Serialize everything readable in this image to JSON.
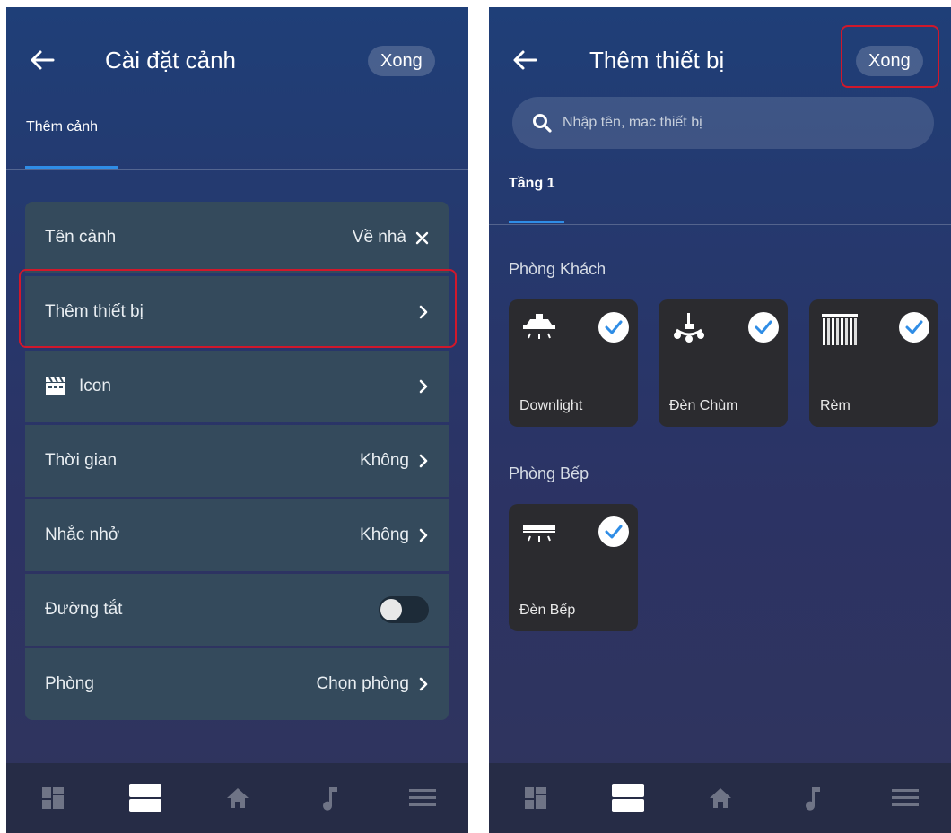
{
  "left": {
    "header": {
      "title": "Cài đặt cảnh",
      "done_label": "Xong"
    },
    "tab": {
      "label": "Thêm cảnh"
    },
    "rows": [
      {
        "label": "Tên cảnh",
        "value": "Về nhà"
      },
      {
        "label": "Thêm thiết bị",
        "value": ""
      },
      {
        "label": "Icon",
        "value": ""
      },
      {
        "label": "Thời gian",
        "value": "Không"
      },
      {
        "label": "Nhắc nhở",
        "value": "Không"
      },
      {
        "label": "Đường tắt",
        "value": "",
        "toggle_on": false
      },
      {
        "label": "Phòng",
        "value": "Chọn phòng"
      }
    ]
  },
  "right": {
    "header": {
      "title": "Thêm thiết bị",
      "done_label": "Xong"
    },
    "search": {
      "placeholder": "Nhập tên, mac thiết bị"
    },
    "tab": {
      "label": "Tầng 1"
    },
    "rooms": [
      {
        "name": "Phòng Khách",
        "devices": [
          {
            "label": "Downlight",
            "icon": "downlight-icon",
            "selected": true
          },
          {
            "label": "Đèn Chùm",
            "icon": "chandelier-icon",
            "selected": true
          },
          {
            "label": "Rèm",
            "icon": "curtain-icon",
            "selected": true
          }
        ]
      },
      {
        "name": "Phòng Bếp",
        "devices": [
          {
            "label": "Đèn Bếp",
            "icon": "kitchen-light-icon",
            "selected": true
          }
        ]
      }
    ]
  },
  "bottom_nav": [
    "dashboard-icon",
    "scenes-icon",
    "home-icon",
    "music-icon",
    "menu-icon"
  ],
  "colors": {
    "accent": "#2f8de6",
    "highlight": "#d0182b",
    "row_bg": "#344a5c",
    "card_bg": "#2b2b2f"
  }
}
